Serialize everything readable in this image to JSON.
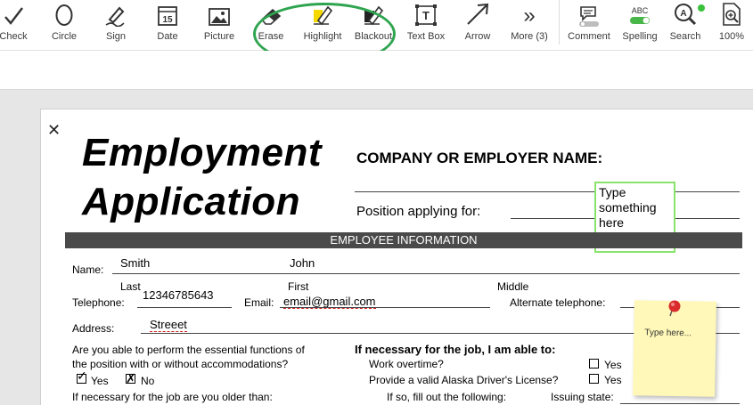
{
  "toolbar": {
    "tools": [
      {
        "label": "Check",
        "icon": "check-icon"
      },
      {
        "label": "Circle",
        "icon": "circle-icon"
      },
      {
        "label": "Sign",
        "icon": "sign-pen-icon"
      },
      {
        "label": "Date",
        "icon": "calendar-icon",
        "icon_text": "15"
      },
      {
        "label": "Picture",
        "icon": "picture-icon"
      },
      {
        "label": "Erase",
        "icon": "eraser-icon"
      },
      {
        "label": "Highlight",
        "icon": "highlight-icon"
      },
      {
        "label": "Blackout",
        "icon": "blackout-icon"
      },
      {
        "label": "Text Box",
        "icon": "textbox-icon",
        "icon_text": "T"
      },
      {
        "label": "Arrow",
        "icon": "arrow-icon"
      },
      {
        "label": "More (3)",
        "icon": "more-icon",
        "icon_text": "»"
      },
      {
        "label": "Comment",
        "icon": "comment-icon"
      },
      {
        "label": "Spelling",
        "icon": "spelling-icon",
        "icon_text": "ABC"
      },
      {
        "label": "Search",
        "icon": "search-icon"
      },
      {
        "label": "100%",
        "icon": "zoom-icon"
      }
    ],
    "annotation_color": "#2fa44f"
  },
  "document": {
    "title_line1": "Employment",
    "title_line2": "Application",
    "company_label": "COMPANY OR EMPLOYER NAME:",
    "position_label": "Position applying for:",
    "textbox_text": "Type something here",
    "section_header": "EMPLOYEE INFORMATION",
    "name_label": "Name:",
    "last_value": "Smith",
    "first_value": "John",
    "last_label": "Last",
    "first_label": "First",
    "middle_label": "Middle",
    "telephone_label": "Telephone:",
    "telephone_value": "12346785643",
    "email_label": "Email:",
    "email_value": "email@gmail.com",
    "alt_phone_label": "Alternate telephone:",
    "address_label": "Address:",
    "address_value": "Streeet",
    "essential_q_line1": "Are you able to perform the essential functions of",
    "essential_q_line2": "the position with or without accommodations?",
    "yes_label": "Yes",
    "no_label": "No",
    "older_q": "If necessary for the job are you older than:",
    "if_necessary_label": "If necessary for the job, I am able to:",
    "work_overtime": "Work overtime?",
    "alaska_license": "Provide a valid Alaska Driver's License?",
    "if_so": "If so, fill out the following:",
    "issuing_state": "Issuing state:",
    "sticky_text": "Type here..."
  }
}
